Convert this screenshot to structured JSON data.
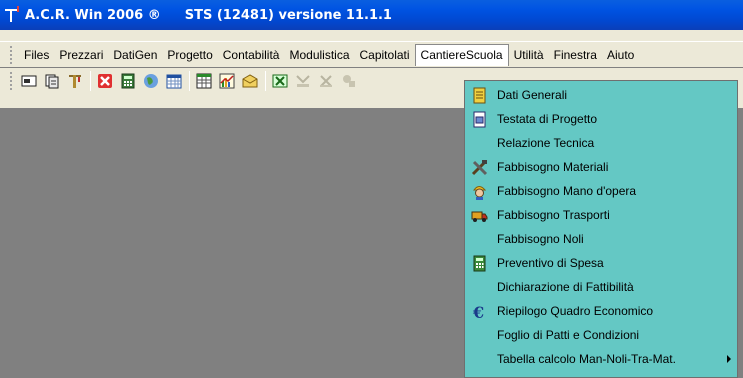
{
  "titlebar": {
    "app_name": "A.C.R. Win 2006 ®",
    "version_label": "STS (12481) versione 11.1.1"
  },
  "menubar": {
    "items": [
      {
        "label": "Files"
      },
      {
        "label": "Prezzari"
      },
      {
        "label": "DatiGen"
      },
      {
        "label": "Progetto"
      },
      {
        "label": "Contabilità"
      },
      {
        "label": "Modulistica"
      },
      {
        "label": "Capitolati"
      },
      {
        "label": "CantiereScuola"
      },
      {
        "label": "Utilità"
      },
      {
        "label": "Finestra"
      },
      {
        "label": "Aiuto"
      }
    ]
  },
  "dropdown": {
    "items": [
      {
        "label": "Dati Generali",
        "icon": "notepad-icon"
      },
      {
        "label": "Testata di Progetto",
        "icon": "document-icon"
      },
      {
        "label": "Relazione Tecnica",
        "icon": ""
      },
      {
        "label": "Fabbisogno Materiali",
        "icon": "tools-icon"
      },
      {
        "label": "Fabbisogno Mano d'opera",
        "icon": "worker-icon"
      },
      {
        "label": "Fabbisogno Trasporti",
        "icon": "truck-icon"
      },
      {
        "label": "Fabbisogno Noli",
        "icon": ""
      },
      {
        "label": "Preventivo di Spesa",
        "icon": "calculator-icon"
      },
      {
        "label": "Dichiarazione di Fattibilità",
        "icon": ""
      },
      {
        "label": "Riepilogo Quadro Economico",
        "icon": "euro-icon"
      },
      {
        "label": "Foglio di Patti e Condizioni",
        "icon": ""
      },
      {
        "label": "Tabella calcolo Man-Noli-Tra-Mat.",
        "icon": "submenu-arrow-icon"
      }
    ]
  },
  "colors": {
    "titlebar": "#0054e3",
    "menubar": "#ece9d8",
    "dropdown": "#64c8c4",
    "workspace": "#808080"
  }
}
